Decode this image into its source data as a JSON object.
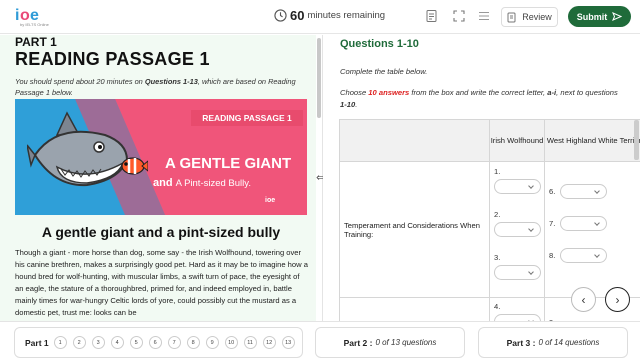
{
  "brand": {
    "logo_text": "ioe",
    "logo_sub": "by IELTS Online"
  },
  "header": {
    "timer_value": "60",
    "timer_label": "minutes remaining",
    "review_label": "Review",
    "submit_label": "Submit"
  },
  "passage": {
    "part_label": "PART 1",
    "title": "READING PASSAGE 1",
    "instruction_pre": "You should spend about 20 minutes on ",
    "instruction_bold": "Questions 1-13",
    "instruction_post": ", which are based on Reading Passage 1 below.",
    "banner": {
      "tag": "READING PASSAGE 1",
      "headline": "A GENTLE GIANT",
      "and": "and",
      "sub": "A Pint-sized Bully.",
      "mini_logo": "ioe"
    },
    "article_title": "A gentle giant and a pint-sized bully",
    "article_body": "Though a giant - more horse than dog, some say - the Irish Wolfhound, towering over his canine brethren, makes a surprisingly good pet. Hard as it may be to imagine how a hound bred for wolf-hunting, with muscular limbs, a swift turn of pace, the eyesight of an eagle, the stature of a thoroughbred, primed for, and indeed employed in, battle mainly times for war-hungry Celtic lords of yore, could possibly cut the mustard as a domestic pet, trust me: looks can be"
  },
  "questions": {
    "heading": "Questions 1-10",
    "instr1": "Complete the table below.",
    "instr2_pre": "Choose ",
    "instr2_red": "10 answers",
    "instr2_mid": " from the box and write the correct letter, ",
    "instr2_bold": "a-i",
    "instr2_post": ", next to questions ",
    "instr2_q": "1-10",
    "instr2_end": ".",
    "table": {
      "col1": "Irish Wolfhound",
      "col2": "West Highland White Terrier",
      "row1_label": "Temperament and Considerations When Training:",
      "q_col1": [
        "1.",
        "2.",
        "3."
      ],
      "q_col2": [
        "6.",
        "7.",
        "8."
      ],
      "q_next": "4.",
      "q_next2": "9."
    }
  },
  "footer": {
    "part1_label": "Part 1",
    "part1_numbers": [
      "1",
      "2",
      "3",
      "4",
      "5",
      "6",
      "7",
      "8",
      "9",
      "10",
      "11",
      "12",
      "13"
    ],
    "part2_label": "Part 2 :",
    "part2_count": "0 of 13 questions",
    "part3_label": "Part 3 :",
    "part3_count": "0 of 14 questions"
  },
  "colors": {
    "brand_green": "#1f6b3a",
    "accent_red": "#d22222",
    "pink": "#e84b6d",
    "blue": "#2f9fd8"
  }
}
